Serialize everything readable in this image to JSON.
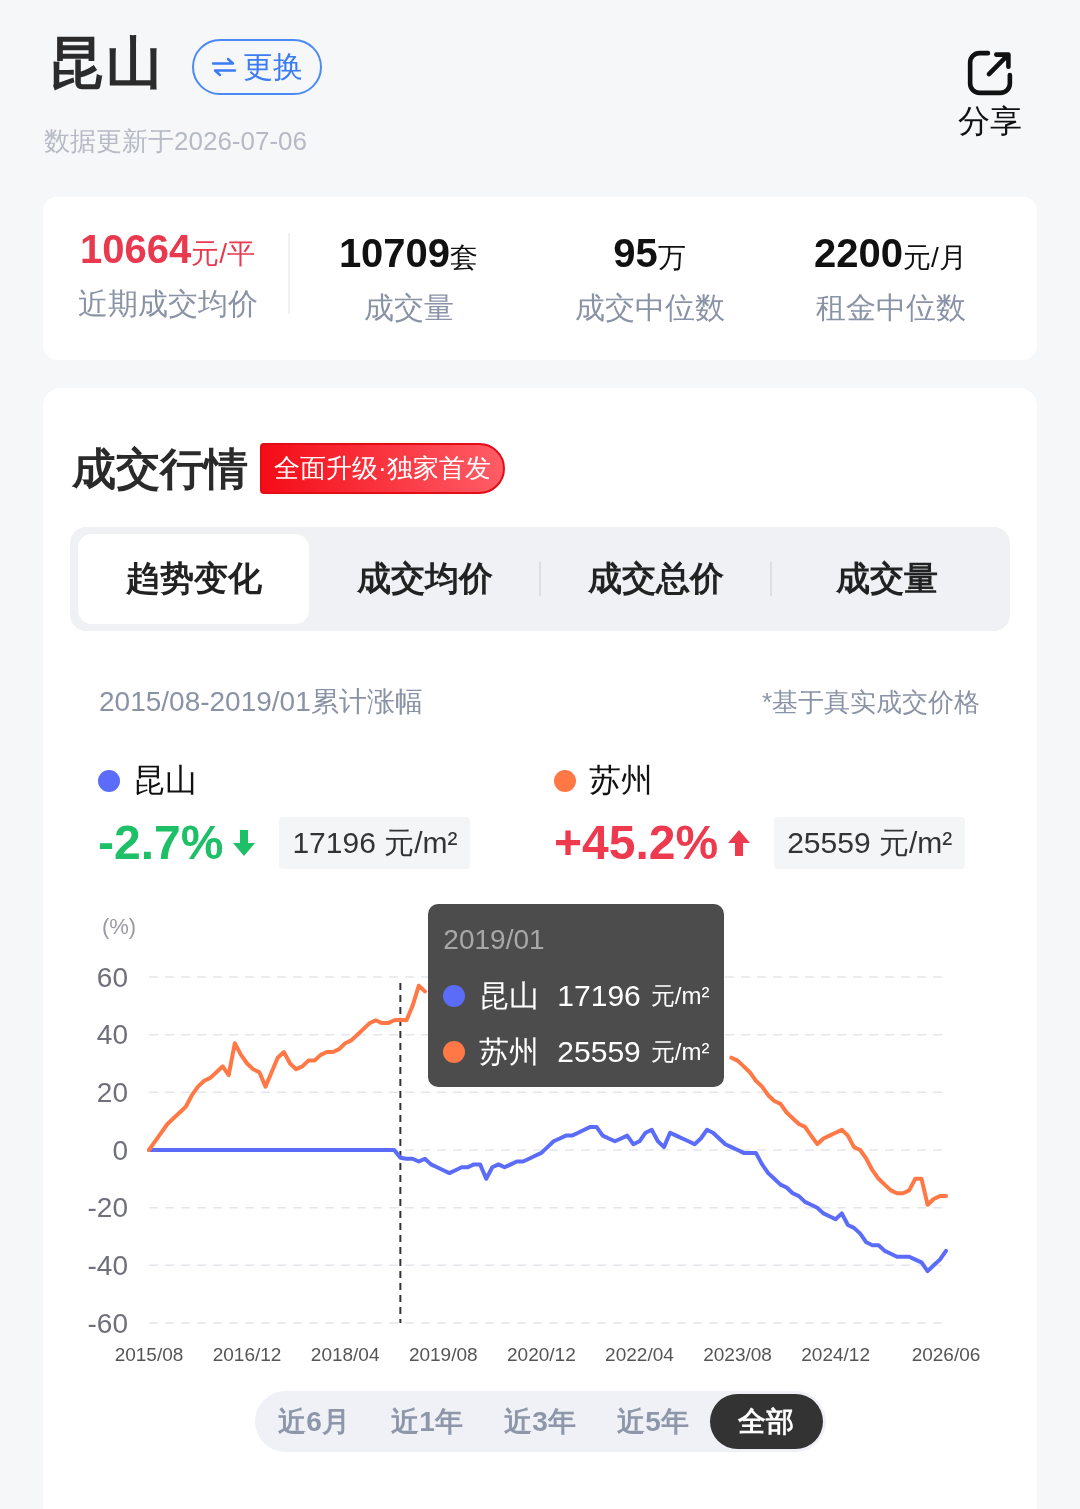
{
  "header": {
    "city": "昆山",
    "switch_button": "更换",
    "updated": "数据更新于2026-07-06",
    "share_button": "分享"
  },
  "stats": [
    {
      "kind": "highlight",
      "value": "10664",
      "unit": "元/平",
      "label": "近期成交均价"
    },
    {
      "kind": "plain",
      "value": "10709",
      "unit": "套",
      "label": "成交量"
    },
    {
      "kind": "plain",
      "value": "95",
      "unit": "万",
      "label": "成交中位数"
    },
    {
      "kind": "plain",
      "value": "2200",
      "unit": "元/月",
      "label": "租金中位数"
    }
  ],
  "market": {
    "title": "成交行情",
    "badge": "全面升级·独家首发",
    "tabs": [
      {
        "label": "趋势变化",
        "selected": true
      },
      {
        "label": "成交均价",
        "selected": false
      },
      {
        "label": "成交总价",
        "selected": false
      },
      {
        "label": "成交量",
        "selected": false
      }
    ],
    "period": "2015/08-2019/01累计涨幅",
    "note": "*基于真实成交价格",
    "comparisons": [
      {
        "name": "昆山",
        "color": "#5b6cf9",
        "change": "-2.7%",
        "kind": "down",
        "price": "17196 元/m²"
      },
      {
        "name": "苏州",
        "color": "#ff7845",
        "change": "+45.2%",
        "kind": "up",
        "price": "25559 元/m²"
      }
    ],
    "chart_data": {
      "type": "line",
      "ylabel": "(%)",
      "grid": true,
      "categories": [
        "2015/08",
        null,
        null,
        null,
        null,
        null,
        null,
        null,
        null,
        null,
        null,
        null,
        null,
        null,
        null,
        null,
        "2016/12",
        null,
        null,
        null,
        null,
        null,
        null,
        null,
        null,
        null,
        null,
        null,
        null,
        null,
        null,
        null,
        "2018/04",
        null,
        null,
        null,
        null,
        null,
        null,
        null,
        null,
        null,
        null,
        null,
        null,
        null,
        null,
        null,
        "2019/08",
        null,
        null,
        null,
        null,
        null,
        null,
        null,
        null,
        null,
        null,
        null,
        null,
        null,
        null,
        null,
        "2020/12",
        null,
        null,
        null,
        null,
        null,
        null,
        null,
        null,
        null,
        null,
        null,
        null,
        null,
        null,
        null,
        "2022/04",
        null,
        null,
        null,
        null,
        null,
        null,
        null,
        null,
        null,
        null,
        null,
        null,
        null,
        null,
        null,
        "2023/08",
        null,
        null,
        null,
        null,
        null,
        null,
        null,
        null,
        null,
        null,
        null,
        null,
        null,
        null,
        null,
        "2024/12",
        null,
        null,
        null,
        null,
        null,
        null,
        null,
        null,
        null,
        null,
        null,
        null,
        null,
        null,
        null,
        null,
        null,
        "2026/06"
      ],
      "ylim": [
        -60,
        60
      ],
      "yticks": [
        -60,
        -40,
        -20,
        0,
        20,
        40,
        60
      ],
      "series": [
        {
          "color": "#5b6cf9",
          "values": [
            0,
            0,
            0,
            0,
            0,
            0,
            0,
            0,
            0,
            0,
            0,
            0,
            0,
            0,
            0,
            0,
            0,
            0,
            0,
            0,
            0,
            0,
            0,
            0,
            0,
            0,
            0,
            0,
            0,
            0,
            0,
            0,
            0,
            0,
            0,
            0,
            0,
            0,
            0,
            0,
            0,
            -2.7,
            -3,
            -3,
            -4,
            -3,
            -5,
            -6,
            -7,
            -8,
            -7,
            -6,
            -6,
            -5,
            -5,
            -10,
            -6,
            -5,
            -6,
            -5,
            -4,
            -4,
            -3,
            -2,
            -1,
            1,
            3,
            4,
            5,
            5,
            6,
            7,
            8,
            8,
            5,
            4,
            3,
            4,
            5,
            2,
            3,
            6,
            7,
            3,
            1,
            6,
            5,
            4,
            3,
            2,
            4,
            7,
            6,
            4,
            2,
            1,
            0,
            -1,
            -1,
            -1,
            -5,
            -8,
            -10,
            -12,
            -13,
            -15,
            -16,
            -18,
            -19,
            -20,
            -22,
            -23,
            -24,
            -22,
            -26,
            -27,
            -29,
            -32,
            -33,
            -33,
            -35,
            -36,
            -37,
            -37,
            -37,
            -38,
            -39,
            -42,
            -40,
            -38,
            -35
          ]
        },
        {
          "color": "#ff7845",
          "values": [
            0,
            3,
            6,
            9,
            11,
            13,
            15,
            19,
            22,
            24,
            25,
            27,
            29,
            26,
            37,
            33,
            30,
            28,
            27,
            22,
            27,
            32,
            34,
            30,
            28,
            29,
            31,
            31,
            33,
            34,
            34,
            35,
            37,
            38,
            40,
            42,
            44,
            45,
            44,
            44,
            45,
            45.2,
            45,
            50,
            57,
            55,
            null,
            null,
            null,
            null,
            null,
            null,
            null,
            null,
            null,
            null,
            null,
            null,
            null,
            null,
            null,
            null,
            null,
            null,
            null,
            null,
            null,
            null,
            null,
            null,
            null,
            null,
            null,
            null,
            null,
            null,
            null,
            null,
            null,
            null,
            null,
            null,
            null,
            null,
            null,
            null,
            null,
            null,
            null,
            null,
            null,
            null,
            null,
            null,
            null,
            32,
            31,
            29,
            27,
            24,
            22,
            19,
            17,
            16,
            13,
            11,
            9,
            8,
            5,
            2,
            4,
            5,
            6,
            7,
            5,
            1,
            0,
            -3,
            -7,
            -10,
            -12,
            -14,
            -15,
            -15,
            -14,
            -10,
            -10,
            -19,
            -17,
            -16,
            -16
          ]
        }
      ]
    },
    "tooltip": {
      "date": "2019/01",
      "rows": [
        {
          "name": "昆山",
          "value": "17196",
          "unit": "元/m²",
          "color": "#5b6cf9"
        },
        {
          "name": "苏州",
          "value": "25559",
          "unit": "元/m²",
          "color": "#ff7845"
        }
      ]
    },
    "ranges": [
      {
        "label": "近6月",
        "selected": false
      },
      {
        "label": "近1年",
        "selected": false
      },
      {
        "label": "近3年",
        "selected": false
      },
      {
        "label": "近5年",
        "selected": false
      },
      {
        "label": "全部",
        "selected": true
      }
    ]
  }
}
